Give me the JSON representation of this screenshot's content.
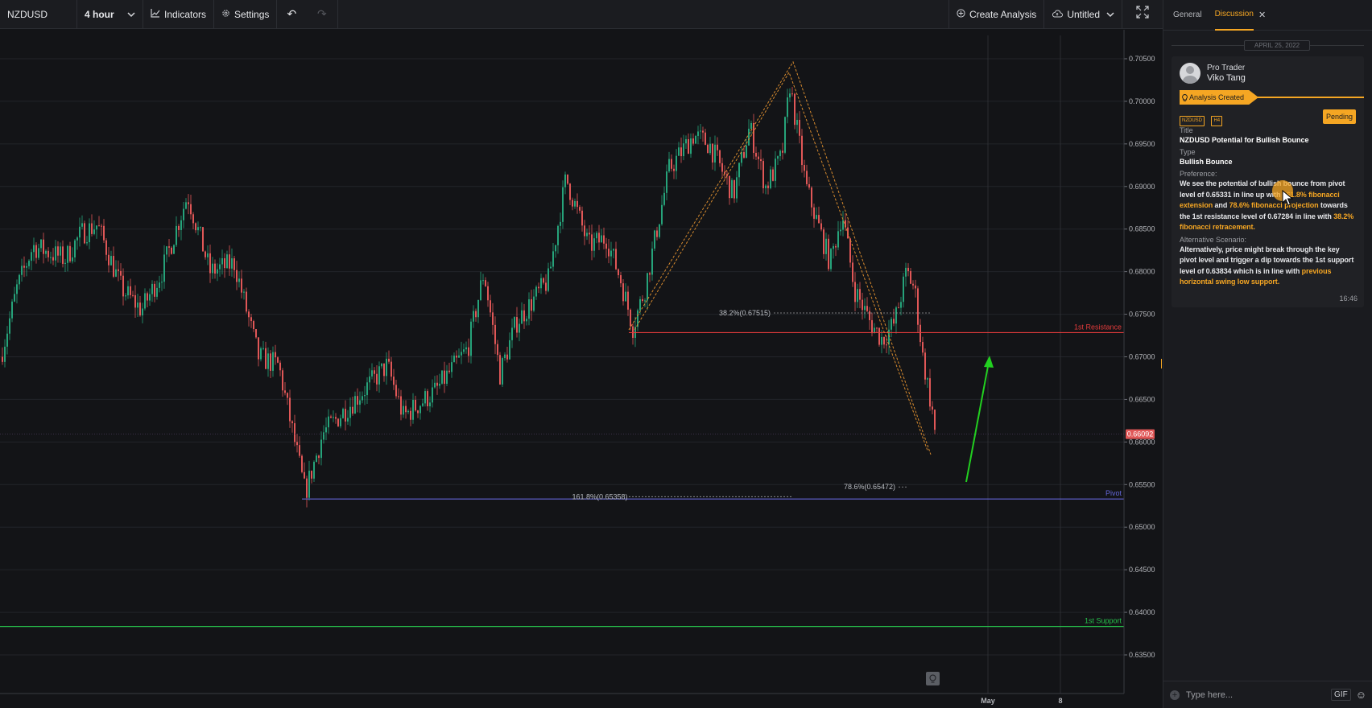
{
  "toolbar": {
    "symbol": "NZDUSD",
    "timeframe": "4 hour",
    "indicators_label": "Indicators",
    "settings_label": "Settings",
    "create_analysis_label": "Create Analysis",
    "untitled_label": "Untitled",
    "icons": [
      "chevron-down-icon",
      "indicators-icon",
      "gear-icon",
      "undo-icon",
      "redo-icon",
      "plus-circle-icon",
      "cloud-icon",
      "fullscreen-icon"
    ]
  },
  "chart": {
    "price_ticks": [
      "0.70500",
      "0.70000",
      "0.69500",
      "0.69000",
      "0.68500",
      "0.68000",
      "0.67500",
      "0.67000",
      "0.66500",
      "0.66000",
      "0.65500",
      "0.65000",
      "0.64500",
      "0.64000",
      "0.63500"
    ],
    "current_price": "0.66092",
    "time_labels": [
      "May",
      "8"
    ],
    "levels": [
      {
        "label": "1st Resistance",
        "price": 0.67284,
        "color": "#e23b3b"
      },
      {
        "label": "Pivot",
        "price": 0.65331,
        "color": "#6466d8"
      },
      {
        "label": "1st Support",
        "price": 0.63834,
        "color": "#27c24c"
      }
    ],
    "fib_labels": [
      {
        "text": "38.2%(0.67515)",
        "price": 0.67515
      },
      {
        "text": "78.6%(0.65472)",
        "price": 0.65472
      },
      {
        "text": "161.8%(0.65358)",
        "price": 0.65358
      }
    ],
    "colors": {
      "up": "#26a37a",
      "down": "#e05757",
      "fib": "#d68a2e",
      "arrow": "#22d020"
    }
  },
  "panel": {
    "tabs": [
      "General",
      "Discussion"
    ],
    "date": "APRIL 25, 2022",
    "author_role": "Pro Trader",
    "author_name": "Viko Tang",
    "status": "Analysis Created",
    "tags": [
      "NZDUSD",
      "H4"
    ],
    "pending": "Pending",
    "title_label": "Title",
    "title": "NZDUSD Potential for Bullish Bounce",
    "type_label": "Type",
    "type": "Bullish Bounce",
    "preference_label": "Preference:",
    "preference": {
      "t1": "We see the potential of bullish bounce from pivot level of 0.65331 in line up with ",
      "h1": "161.8% fibonacci extension",
      "t2": " and ",
      "h2": "78.6% fibonacci projection",
      "t3": " towards the 1st resistance level of 0.67284 in line with ",
      "h3": "38.2% fibonacci retracement."
    },
    "alt_label": "Alternative Scenario:",
    "alternative": {
      "t1": "Alternatively, price might break through the key pivot level and trigger a dip towards the 1st support level of 0.63834 which is in line with ",
      "h1": "previous horizontal swing low support."
    },
    "time": "16:46",
    "composer_placeholder": "Type here...",
    "gif": "GIF"
  }
}
